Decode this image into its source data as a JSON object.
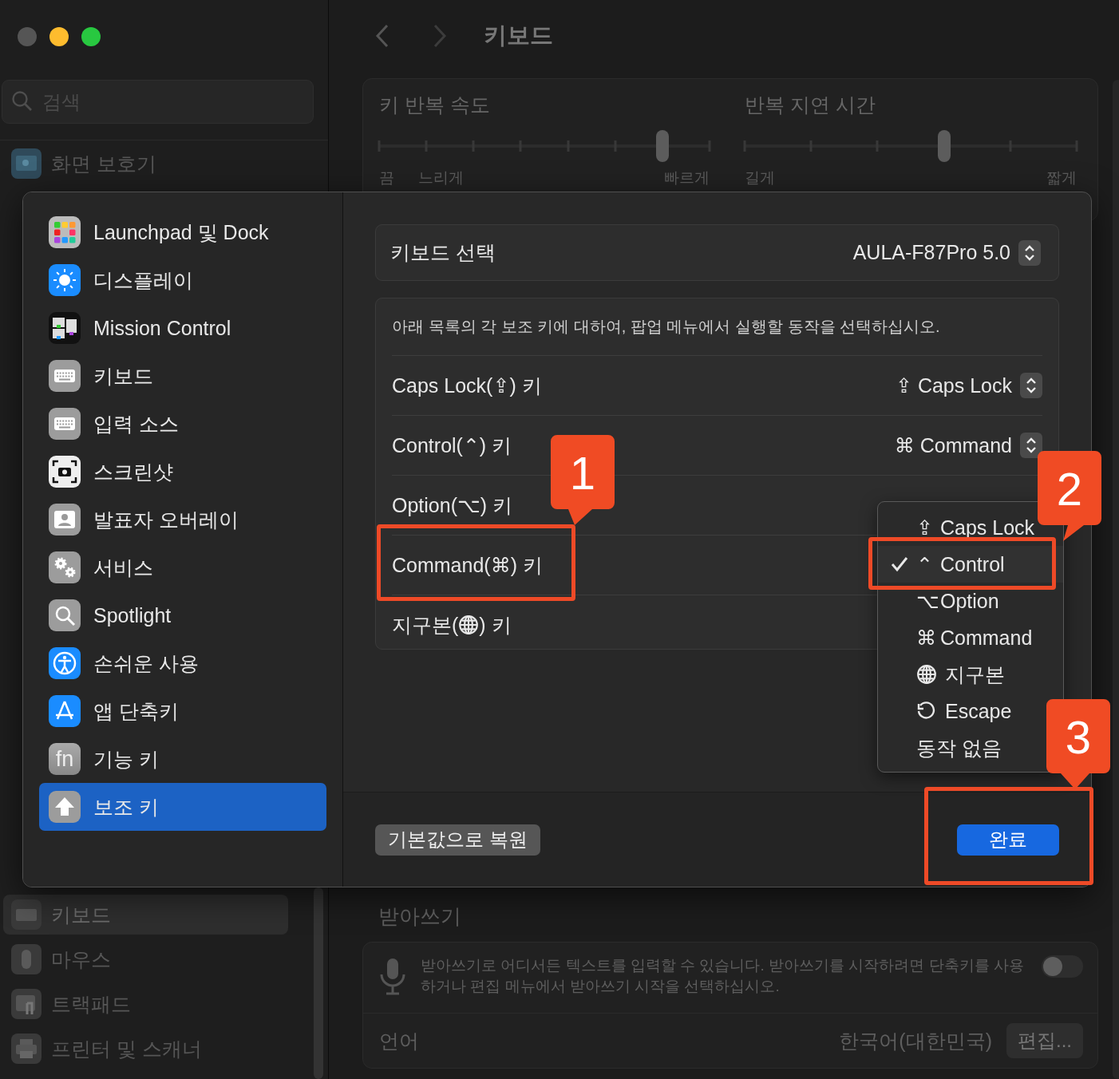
{
  "sidebar": {
    "search": {
      "placeholder": "검색"
    },
    "top_items": [
      {
        "label": "화면 보호기",
        "selected": false
      }
    ],
    "bottom_items": [
      {
        "label": "키보드",
        "selected": true
      },
      {
        "label": "마우스",
        "selected": false
      },
      {
        "label": "트랙패드",
        "selected": false
      },
      {
        "label": "프린터 및 스캐너",
        "selected": false
      }
    ]
  },
  "header": {
    "title": "키보드"
  },
  "sliders": [
    {
      "title": "키 반복 속도",
      "level": 0.857,
      "low_labels": [
        "끔",
        "느리게"
      ],
      "high_label": "빠르게"
    },
    {
      "title": "반복 지연 시간",
      "level": 0.6,
      "low_labels": [
        "길게"
      ],
      "high_label": "짧게"
    }
  ],
  "dictation": {
    "title": "받아쓰기",
    "description": "받아쓰기로 어디서든 텍스트를 입력할 수 있습니다. 받아쓰기를 시작하려면 단축키를 사용하거나 편집 메뉴에서 받아쓰기 시작을 선택하십시오.",
    "on": false,
    "language_label": "언어",
    "language_value": "한국어(대한민국)",
    "edit_button": "편집..."
  },
  "sheet": {
    "nav_items": [
      {
        "label": "Launchpad 및 Dock",
        "selected": false
      },
      {
        "label": "디스플레이",
        "selected": false
      },
      {
        "label": "Mission Control",
        "selected": false
      },
      {
        "label": "키보드",
        "selected": false
      },
      {
        "label": "입력 소스",
        "selected": false
      },
      {
        "label": "스크린샷",
        "selected": false
      },
      {
        "label": "발표자 오버레이",
        "selected": false
      },
      {
        "label": "서비스",
        "selected": false
      },
      {
        "label": "Spotlight",
        "selected": false
      },
      {
        "label": "손쉬운 사용",
        "selected": false
      },
      {
        "label": "앱 단축키",
        "selected": false
      },
      {
        "label": "기능 키",
        "selected": false,
        "icon_text": "fn"
      },
      {
        "label": "보조 키",
        "selected": true
      }
    ],
    "keyboard_select": {
      "label": "키보드 선택",
      "value": "AULA-F87Pro 5.0"
    },
    "description": "아래 목록의 각 보조 키에 대하여, 팝업 메뉴에서 실행할 동작을 선택하십시오.",
    "rows": [
      {
        "kind": "text",
        "label": "Caps Lock(⇪) 키",
        "value": "⇪ Caps Lock"
      },
      {
        "kind": "text",
        "label": "Control(⌃) 키",
        "value": "⌘ Command"
      },
      {
        "kind": "text",
        "label": "Option(⌥) 키"
      },
      {
        "kind": "text",
        "label": "Command(⌘) 키"
      },
      {
        "kind": "globe",
        "label_parts": [
          "지구본(",
          ") 키"
        ]
      }
    ],
    "restore_button": "기본값으로 복원",
    "done_button": "완료"
  },
  "menu": {
    "items": [
      {
        "kind": "symbol",
        "symbol": "⇪",
        "label": "Caps Lock",
        "selected": false
      },
      {
        "kind": "symbol",
        "symbol": "⌃",
        "label": "Control",
        "selected": true
      },
      {
        "kind": "symbol",
        "symbol": "⌥",
        "label": "Option",
        "selected": false
      },
      {
        "kind": "symbol",
        "symbol": "⌘",
        "label": "Command",
        "selected": false
      },
      {
        "kind": "globe",
        "label": "지구본",
        "selected": false
      },
      {
        "kind": "escape",
        "label": "Escape",
        "selected": false
      },
      {
        "kind": "plain",
        "label": "동작 없음",
        "selected": false
      }
    ]
  },
  "callouts": [
    {
      "number": "1"
    },
    {
      "number": "2"
    },
    {
      "number": "3"
    }
  ]
}
